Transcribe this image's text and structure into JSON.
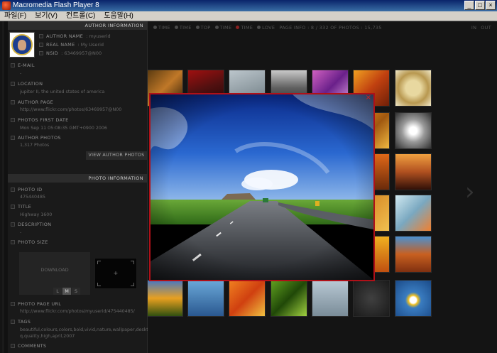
{
  "window": {
    "title": "Macromedia Flash Player 8",
    "buttons": [
      "_",
      "□",
      "×"
    ]
  },
  "menu": [
    {
      "label": "파일(F)"
    },
    {
      "label": "보기(V)"
    },
    {
      "label": "컨트롤(C)"
    },
    {
      "label": "도움말(H)"
    }
  ],
  "topbar": {
    "items": [
      "TIME",
      "TIME",
      "TOP",
      "TIME",
      "TIME",
      "LOVE"
    ],
    "page_info": "PAGE INFO : 8 / 332 OF PHOTOS : 15,735",
    "right": [
      "IN",
      "OUT"
    ]
  },
  "author": {
    "header": "AUTHOR INFORMATION",
    "name_label": "AUTHOR NAME",
    "name_value": ": myuserid",
    "real_label": "REAL NAME",
    "real_value": ": My Userid",
    "nsid_label": "NSID",
    "nsid_value": ": 63469957@N00",
    "email_label": "E-MAIL",
    "email_value": "-",
    "location_label": "LOCATION",
    "location_value": "jupiter II, the united states of america",
    "page_label": "AUTHOR PAGE",
    "page_value": "http://www.flickr.com/photos/63469957@N00",
    "first_label": "PHOTOS FIRST DATE",
    "first_value": "Mon Sep 11 05:08:35 GMT+0900 2006",
    "photos_label": "AUTHOR PHOTOS",
    "photos_value": "1,317 Photos",
    "view_button": "VIEW AUTHOR PHOTOS"
  },
  "photo": {
    "header": "PHOTO INFORMATION",
    "id_label": "PHOTO ID",
    "id_value": "475440485",
    "title_label": "TITLE",
    "title_value": "Highway 1600",
    "desc_label": "DESCRIPTION",
    "desc_value": "-",
    "size_label": "PHOTO SIZE",
    "download_label": "DOWNLOAD",
    "sizes": [
      "L",
      "M",
      "S"
    ],
    "preview_plus": "+",
    "url_label": "PHOTO PAGE URL",
    "url_value": "http://www.flickr.com/photos/myuserid/475440485/",
    "tags_label": "TAGS",
    "tags_value_1": "beautiful,colours,colors,bold,vivid,nature,wallpaper,desktop,h",
    "tags_value_2": "q,quality,high,april,2007",
    "comments_label": "COMMENTS"
  },
  "viewer": {
    "close": "×"
  },
  "colors": {
    "accent_red": "#b01018",
    "panel_bg": "#1a1a1a"
  }
}
